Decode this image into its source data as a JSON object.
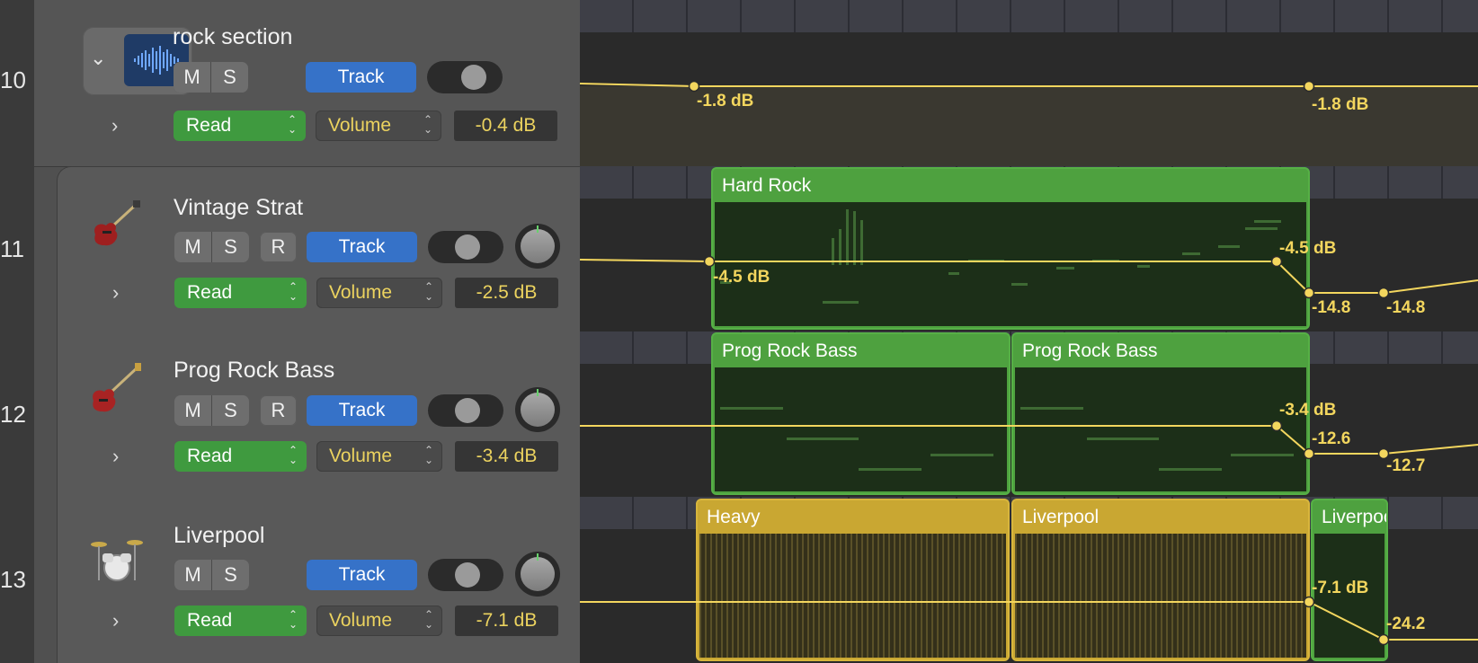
{
  "tracks": [
    {
      "number": "10",
      "name": "rock section",
      "mute": "M",
      "solo": "S",
      "track_button": "Track",
      "mode": "Read",
      "parameter": "Volume",
      "value": "-0.4 dB",
      "icon": "waveform-folder-icon"
    },
    {
      "number": "11",
      "name": "Vintage Strat",
      "mute": "M",
      "solo": "S",
      "record": "R",
      "track_button": "Track",
      "mode": "Read",
      "parameter": "Volume",
      "value": "-2.5 dB",
      "icon": "electric-guitar-icon"
    },
    {
      "number": "12",
      "name": "Prog Rock Bass",
      "mute": "M",
      "solo": "S",
      "record": "R",
      "track_button": "Track",
      "mode": "Read",
      "parameter": "Volume",
      "value": "-3.4 dB",
      "icon": "bass-guitar-icon"
    },
    {
      "number": "13",
      "name": "Liverpool",
      "mute": "M",
      "solo": "S",
      "track_button": "Track",
      "mode": "Read",
      "parameter": "Volume",
      "value": "-7.1 dB",
      "icon": "drum-kit-icon"
    }
  ],
  "regions": {
    "hard_rock": "Hard Rock",
    "bass_1": "Prog Rock Bass",
    "bass_2": "Prog Rock Bass",
    "heavy": "Heavy",
    "liverpool_1": "Liverpool",
    "liverpool_2": "Liverpool"
  },
  "automation_labels": {
    "t10_a": "-1.8 dB",
    "t10_b": "-1.8 dB",
    "t11_a": "-4.5 dB",
    "t11_b": "-4.5 dB",
    "t11_c": "-14.8",
    "t11_d": "-14.8",
    "t12_a": "-3.4 dB",
    "t12_b": "-12.6",
    "t12_c": "-12.7",
    "t13_a": "-7.1 dB",
    "t13_b": "-24.2"
  },
  "colors": {
    "track_button": "#3672c8",
    "read_mode": "#3f9a3f",
    "midi_region": "#4ea13f",
    "audio_region": "#c9a732",
    "automation": "#f3d65e"
  }
}
